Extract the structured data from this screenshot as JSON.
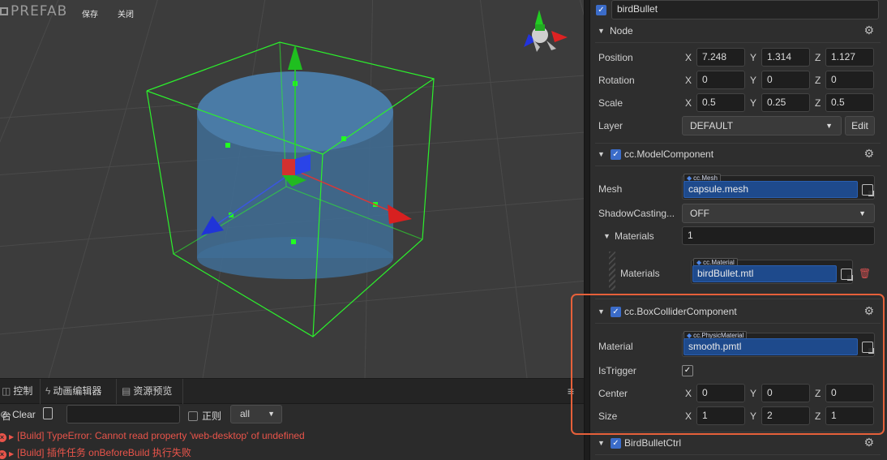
{
  "scene": {
    "title": "PREFAB",
    "save_label": "保存",
    "close_label": "关闭"
  },
  "console": {
    "tabs": [
      {
        "label": "控制台",
        "icon": "console-icon"
      },
      {
        "label": "动画编辑器",
        "icon": "animation-icon"
      },
      {
        "label": "资源预览",
        "icon": "document-icon"
      }
    ],
    "clear_label": "Clear",
    "regex_label": "正则",
    "filter_value": "all",
    "logs": [
      "[Build] TypeError: Cannot read property 'web-desktop' of undefined",
      "[Build] 插件任务 onBeforeBuild 执行失败"
    ]
  },
  "inspector": {
    "node_name": "birdBullet",
    "node": {
      "title": "Node",
      "position_label": "Position",
      "rotation_label": "Rotation",
      "scale_label": "Scale",
      "layer_label": "Layer",
      "position": {
        "x": "7.248",
        "y": "1.314",
        "z": "1.127"
      },
      "rotation": {
        "x": "0",
        "y": "0",
        "z": "0"
      },
      "scale": {
        "x": "0.5",
        "y": "0.25",
        "z": "0.5"
      },
      "layer_value": "DEFAULT",
      "edit_label": "Edit"
    },
    "axis": {
      "x": "X",
      "y": "Y",
      "z": "Z"
    },
    "model": {
      "title": "cc.ModelComponent",
      "mesh_label": "Mesh",
      "mesh_type": "cc.Mesh",
      "mesh_value": "capsule.mesh",
      "shadow_label": "ShadowCasting...",
      "shadow_value": "OFF",
      "materials_label": "Materials",
      "materials_count": "1",
      "material_item_label": "Materials",
      "material_type": "cc.Material",
      "material_value": "birdBullet.mtl"
    },
    "box": {
      "title": "cc.BoxColliderComponent",
      "material_label": "Material",
      "material_type": "cc.PhysicMaterial",
      "material_value": "smooth.pmtl",
      "trigger_label": "IsTrigger",
      "center_label": "Center",
      "size_label": "Size",
      "center": {
        "x": "0",
        "y": "0",
        "z": "0"
      },
      "size": {
        "x": "1",
        "y": "2",
        "z": "1"
      }
    },
    "ctrl": {
      "title": "BirdBulletCtrl"
    }
  },
  "colors": {
    "accent": "#3b6cc9",
    "highlight": "#e6603a",
    "error": "#e9544a",
    "bounding_box": "#22ff22"
  }
}
